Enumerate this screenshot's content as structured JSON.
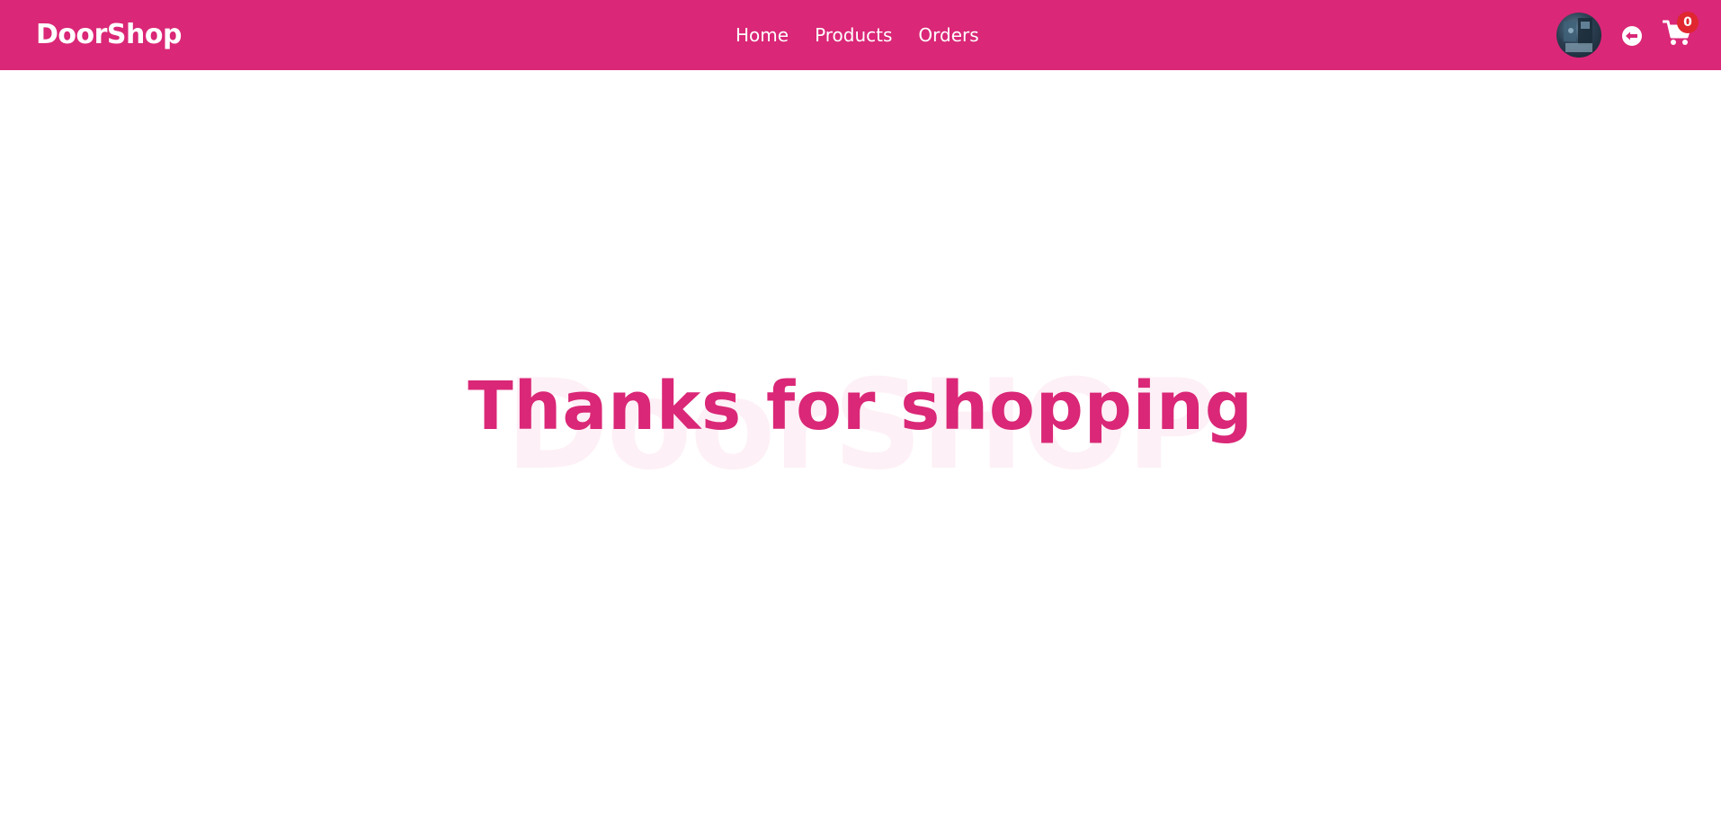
{
  "navbar": {
    "brand": "DoorShop",
    "links": [
      {
        "label": "Home"
      },
      {
        "label": "Products"
      },
      {
        "label": "Orders"
      }
    ],
    "cart_count": "0",
    "background_color": "#da2777",
    "icons": {
      "avatar": "user-avatar",
      "logout": "logout-arrow-icon",
      "cart": "shopping-cart-icon"
    }
  },
  "hero": {
    "watermark": "DoorSHOP",
    "headline": "Thanks for shopping",
    "headline_color": "#da2777"
  }
}
